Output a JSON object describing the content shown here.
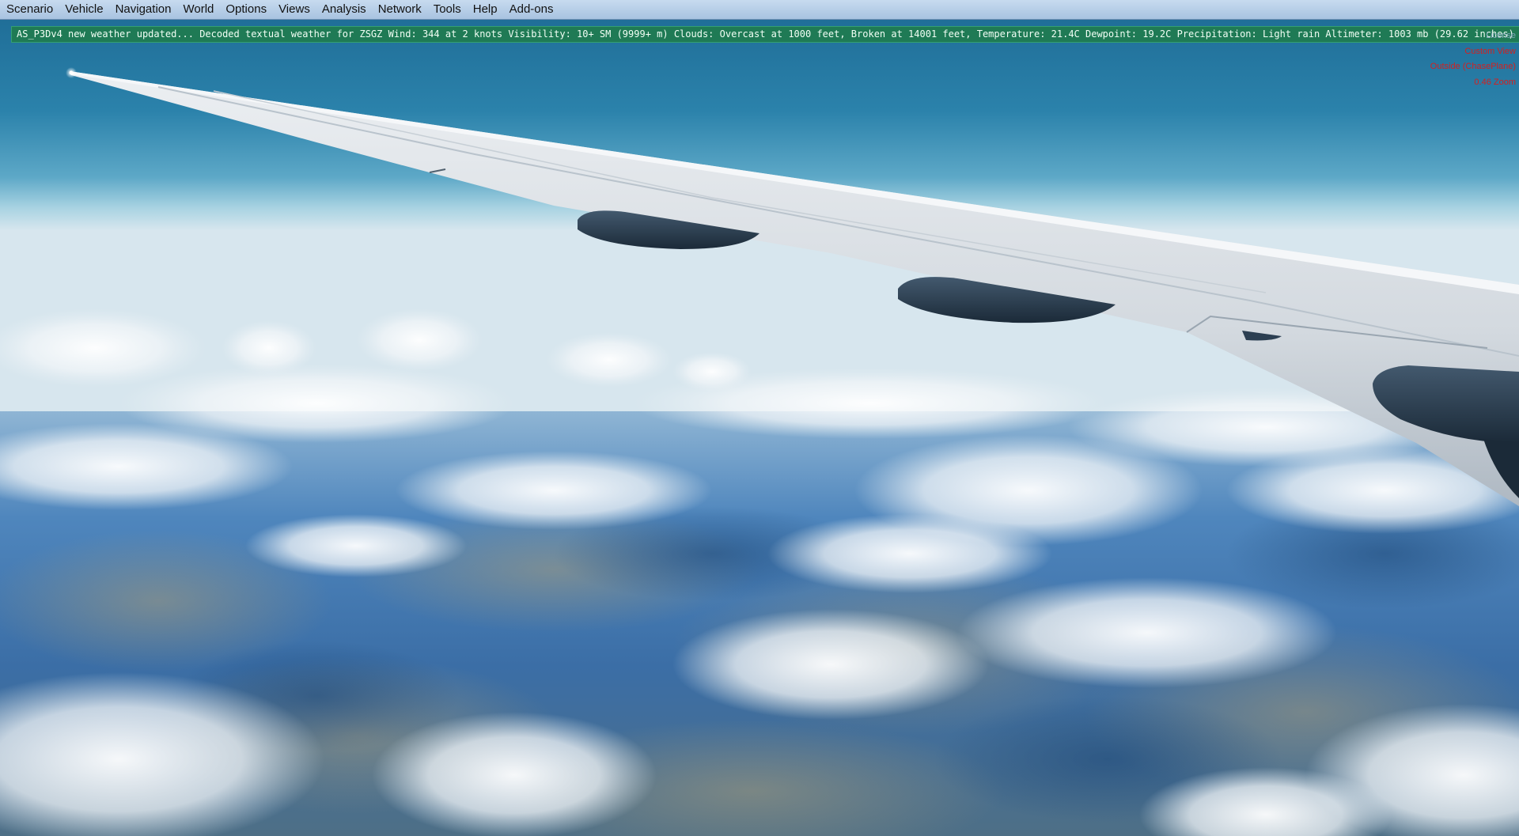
{
  "menubar": {
    "items": [
      {
        "label": "Scenario"
      },
      {
        "label": "Vehicle"
      },
      {
        "label": "Navigation"
      },
      {
        "label": "World"
      },
      {
        "label": "Options"
      },
      {
        "label": "Views"
      },
      {
        "label": "Analysis"
      },
      {
        "label": "Network"
      },
      {
        "label": "Tools"
      },
      {
        "label": "Help"
      },
      {
        "label": "Add-ons"
      }
    ]
  },
  "weather_bar": {
    "text": "AS_P3Dv4 new weather updated... Decoded textual weather for ZSGZ  Wind: 344 at 2 knots  Visibility: 10+ SM (9999+ m) Clouds: Overcast at 1000 feet, Broken at 14001 feet,  Temperature: 21.4C Dewpoint: 19.2C Precipitation: Light rain  Altimeter: 1003 mb (29.62 inches)"
  },
  "overlay": {
    "license": "License",
    "view_mode": "Custom View",
    "camera": "Outside (ChasePlane)",
    "zoom": "0.46 Zoom"
  },
  "colors": {
    "sky_top": "#1f6f99",
    "sky_horizon": "#a9d3e2",
    "wing": "#d9dee3",
    "engine": "#2c3f52",
    "weather_bg": "#1f7a55",
    "overlay_red": "#d32020"
  }
}
